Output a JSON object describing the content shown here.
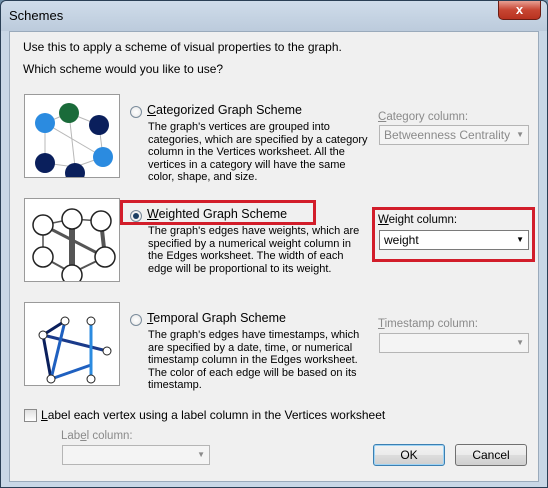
{
  "dialog": {
    "title": "Schemes",
    "close_label": "x",
    "intro": "Use this to apply a scheme of visual properties to the graph.",
    "question": "Which scheme would you like to use?"
  },
  "schemes": [
    {
      "name_first": "C",
      "name_rest": "ategorized Graph Scheme",
      "description": "The graph's vertices are grouped into categories, which are specified by a category column in the Vertices worksheet.  All the vertices in a category will have the same color, shape, and size.",
      "column_label_first": "C",
      "column_label_rest": "ategory column:",
      "column_value": "Betweenness Centrality",
      "selected": false,
      "enabled": false
    },
    {
      "name_first": "W",
      "name_rest": "eighted Graph Scheme",
      "description": "The graph's edges have weights, which are specified by a numerical weight column in the Edges worksheet.  The width of each edge will be proportional to its weight.",
      "column_label_first": "W",
      "column_label_rest": "eight column:",
      "column_value": "weight",
      "selected": true,
      "enabled": true
    },
    {
      "name_first": "T",
      "name_rest": "emporal Graph Scheme",
      "description": "The graph's edges have timestamps, which are specified by a date, time, or numerical timestamp column in the Edges worksheet.  The color of each edge will be based on its timestamp.",
      "column_label_first": "T",
      "column_label_rest": "imestamp column:",
      "column_value": "",
      "selected": false,
      "enabled": false
    }
  ],
  "label_vertex": {
    "checkbox_first": "L",
    "checkbox_rest": "abel each vertex using a label column in the Vertices worksheet",
    "checked": false,
    "column_label_pre": "Lab",
    "column_label_u": "e",
    "column_label_post": "l column:",
    "column_value": ""
  },
  "buttons": {
    "ok": "OK",
    "cancel": "Cancel"
  },
  "colors": {
    "highlight": "#d21d2a",
    "node_dark": "#0a1f5c",
    "node_light": "#2b8be0",
    "node_green": "#1a6b3a"
  }
}
